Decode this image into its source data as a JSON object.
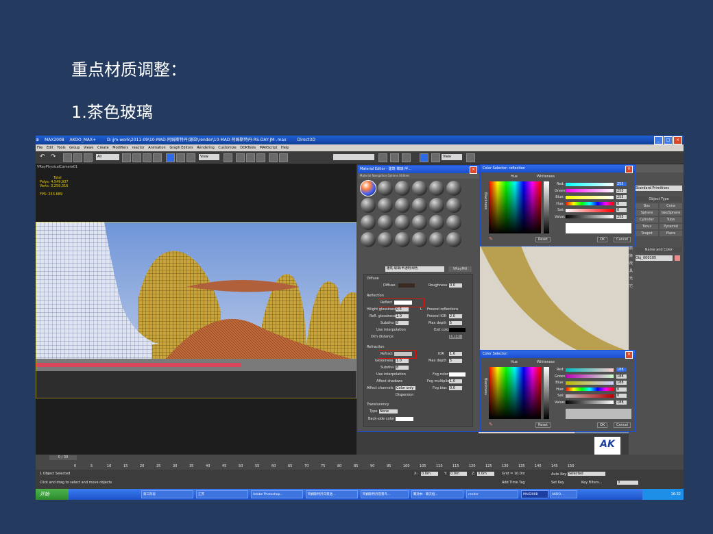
{
  "slide": {
    "heading": "重点材质调整：",
    "subheading": "1.茶色玻璃"
  },
  "app": {
    "title_parts": [
      "MAX2008",
      "AKOO_MAX+",
      "D:\\jm-work\\2011-09\\10-MAD-阿姆斯特丹\\源染\\render\\10-MAD-阿姆斯特丹-RS-DAY-JM-.max",
      "Direct3D"
    ],
    "menu": [
      "File",
      "Edit",
      "Tools",
      "Group",
      "Views",
      "Create",
      "Modifiers",
      "reactor",
      "Animation",
      "Graph Editors",
      "Rendering",
      "Customize",
      "DDKTools",
      "MAXScript",
      "Help"
    ],
    "toolbar": {
      "selection_filter": "All",
      "ref_coord": "View",
      "view_dropdown": "View"
    }
  },
  "viewport": {
    "label": "VRayPhysicalCamera01",
    "stats": {
      "total_label": "Total",
      "polys_label": "Polys:",
      "polys": "4,549,937",
      "verts_label": "Verts:",
      "verts": "3,259,316",
      "fps_label": "FPS:",
      "fps": "253.689"
    }
  },
  "material_editor": {
    "title": "Material Editor - 建筑-玻璃(半...",
    "menu": [
      "Material",
      "Navigation",
      "Options",
      "Utilities"
    ],
    "material_name": "建筑-玻璃(半透明)绿色",
    "material_type": "VRayMtl",
    "diffuse": {
      "section": "Diffuse",
      "diffuse_label": "Diffuse",
      "roughness_label": "Roughness",
      "roughness": "0.0"
    },
    "reflection": {
      "section": "Reflection",
      "reflect_label": "Reflect",
      "hilight_label": "Hilight glossiness",
      "hilight": "0.5",
      "l_label": "L",
      "fresnel_label": "Fresnel reflections",
      "refl_gloss_label": "Refl. glossiness",
      "refl_gloss": "1.0",
      "fresnel_ior_label": "Fresnel IOR",
      "fresnel_ior": "2.0",
      "subdivs_label": "Subdivs",
      "subdivs": "8",
      "max_depth_label": "Max depth",
      "max_depth": "5",
      "use_interp_label": "Use interpolation",
      "exit_color_label": "Exit color",
      "dim_distance_label": "Dim distance",
      "dim_distance": "100.0"
    },
    "refraction": {
      "section": "Refraction",
      "refract_label": "Refract",
      "ior_label": "IOR",
      "ior": "1.6",
      "glossiness_label": "Glossiness",
      "glossiness": "1.0",
      "max_depth_label": "Max depth",
      "max_depth": "5",
      "subdivs_label": "Subdivs",
      "subdivs": "8",
      "use_interp_label": "Use interpolation",
      "fog_color_label": "Fog color",
      "affect_shadows_label": "Affect shadows",
      "fog_mult_label": "Fog multiplier",
      "fog_mult": "1.0",
      "affect_channels_label": "Affect channels",
      "affect_channels": "Color only",
      "fog_bias_label": "Fog bias",
      "fog_bias": "0.0",
      "dispersion_label": "Dispersion"
    },
    "translucency": {
      "section": "Translucency",
      "type_label": "Type",
      "type": "None",
      "backside_label": "Back-side color"
    }
  },
  "color_selector_reflection": {
    "title": "Color Selector: reflection",
    "hue_label": "Hue",
    "whiteness_label": "Whiteness",
    "blackness_label": "Blackness",
    "red_label": "Red:",
    "red": "255",
    "green_label": "Green:",
    "green": "255",
    "blue_label": "Blue:",
    "blue": "255",
    "hue_field_label": "Hue:",
    "hue": "0",
    "sat_label": "Sat:",
    "sat": "0",
    "value_label": "Value:",
    "value": "255",
    "reset": "Reset",
    "ok": "OK",
    "cancel": "Cancel"
  },
  "color_selector_2": {
    "title": "Color Selector:",
    "hue_label": "Hue",
    "whiteness_label": "Whiteness",
    "blackness_label": "Blackness",
    "red_label": "Red:",
    "red": "188",
    "green_label": "Green:",
    "green": "188",
    "blue_label": "Blue:",
    "blue": "188",
    "hue_field_label": "Hue:",
    "hue": "0",
    "sat_label": "Sat:",
    "sat": "0",
    "value_label": "Value:",
    "value": "188",
    "reset": "Reset",
    "ok": "OK",
    "cancel": "Cancel"
  },
  "command_panel": {
    "dropdown": "Standard Primitives",
    "object_type": "Object Type",
    "buttons": [
      "Box",
      "Cone",
      "Sphere",
      "GeoSphere",
      "Cylinder",
      "Tube",
      "Torus",
      "Pyramid",
      "Teapot",
      "Plane"
    ],
    "name_and_color": "Name and Color",
    "object_name": "Obj_000105",
    "cn_tabs": [
      "材质",
      "渲染",
      "修改",
      "工具",
      "灯光",
      "其它"
    ]
  },
  "timeline": {
    "frame": "0 / 30",
    "ticks": [
      "0",
      "5",
      "10",
      "15",
      "20",
      "25",
      "30",
      "35",
      "40",
      "45",
      "50",
      "55",
      "60",
      "65",
      "70",
      "75",
      "80",
      "85",
      "90",
      "95",
      "100",
      "105",
      "110",
      "115",
      "120",
      "125",
      "130",
      "135",
      "140",
      "145",
      "150"
    ]
  },
  "status": {
    "selected": "1 Object Selected",
    "prompt": "Click and drag to select and move objects",
    "x": "0.0m",
    "y": "0.0m",
    "z": "0.0m",
    "grid": "Grid = 10.0m",
    "add_time_tag": "Add Time Tag",
    "auto_key": "Auto Key",
    "set_key": "Set Key",
    "key_filters": "Key Filters...",
    "selected_dropdown": "Selected",
    "frame_field": "0"
  },
  "logo": {
    "letters": "AK",
    "caption": "设置 卸载 帮助"
  },
  "taskbar": {
    "start": "开始",
    "tasks": [
      "第三阶段",
      "江苏",
      "Adobe Photoshop...",
      "阿姆斯特丹日景透...",
      "阿姆斯特丹夜景鸟...",
      "聚效林 - 聊天框...",
      "render",
      "MAX2008",
      "AKOO..."
    ],
    "clock": "16:32"
  }
}
